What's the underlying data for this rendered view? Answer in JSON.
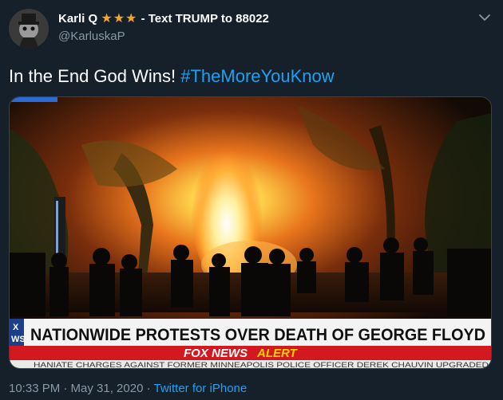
{
  "author": {
    "name": "Karli Q",
    "stars": "★★★",
    "name_suffix": "- Text TRUMP to 88022",
    "handle": "@KarluskaP"
  },
  "tweet": {
    "text": "In the End God Wins! ",
    "hashtag": "#TheMoreYouKnow"
  },
  "media": {
    "chyron_headline": "NATIONWIDE PROTESTS OVER DEATH OF GEORGE FLOYD",
    "network_label": "FOX NEWS",
    "alert_label": "ALERT",
    "channel_bug": "X\nWS",
    "ticker_text": "HANIATE CHARGES AGAINST FORMER MINNEAPOLIS POLICE OFFICER DEREK CHAUVIN UPGRADED"
  },
  "footer": {
    "timestamp": "10:33 PM · May 31, 2020 · ",
    "source": "Twitter for iPhone"
  },
  "colors": {
    "background": "#15202b",
    "link": "#1da1f2",
    "secondary_text": "#8899a6",
    "star": "#f5a623",
    "chyron_red": "#d4181f"
  },
  "icons": {
    "chevron": "chevron-down-icon",
    "avatar": "avatar-image"
  }
}
